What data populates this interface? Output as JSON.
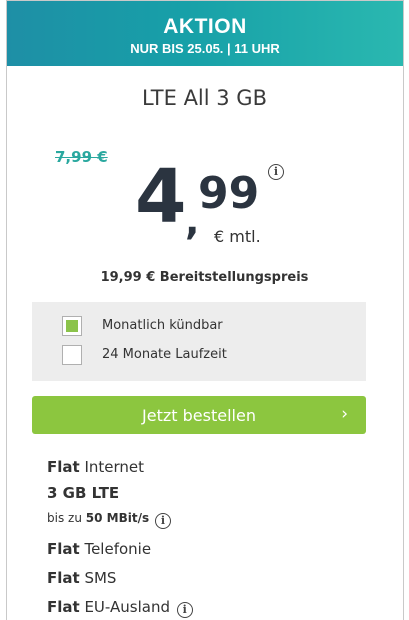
{
  "banner": {
    "title": "AKTION",
    "subtitle": "NUR BIS 25.05. | 11 UHR"
  },
  "plan": {
    "name": "LTE All 3 GB"
  },
  "pricing": {
    "old_price": "7,99 €",
    "price_int": "4",
    "price_comma": ",",
    "price_dec": "99",
    "unit": "€ mtl.",
    "info": "i",
    "setup_fee": "19,99 € Bereitstellungspreis"
  },
  "options": [
    {
      "label": "Monatlich kündbar",
      "checked": true
    },
    {
      "label": "24 Monate Laufzeit",
      "checked": false
    }
  ],
  "cta": {
    "label": "Jetzt bestellen",
    "chevron": "›"
  },
  "features": {
    "internet": {
      "bold": "Flat",
      "text": " Internet"
    },
    "volume": {
      "bold": "3 GB LTE"
    },
    "speed": {
      "prefix": "bis zu ",
      "bold": "50 MBit/s"
    },
    "telefonie": {
      "bold": "Flat",
      "text": " Telefonie"
    },
    "sms": {
      "bold": "Flat",
      "text": " SMS"
    },
    "eu": {
      "bold": "Flat",
      "text": " EU-Ausland"
    },
    "info": "i"
  },
  "colors": {
    "banner": "#17a0a8",
    "accent": "#8cc63f",
    "old_price": "#2aa89f"
  }
}
